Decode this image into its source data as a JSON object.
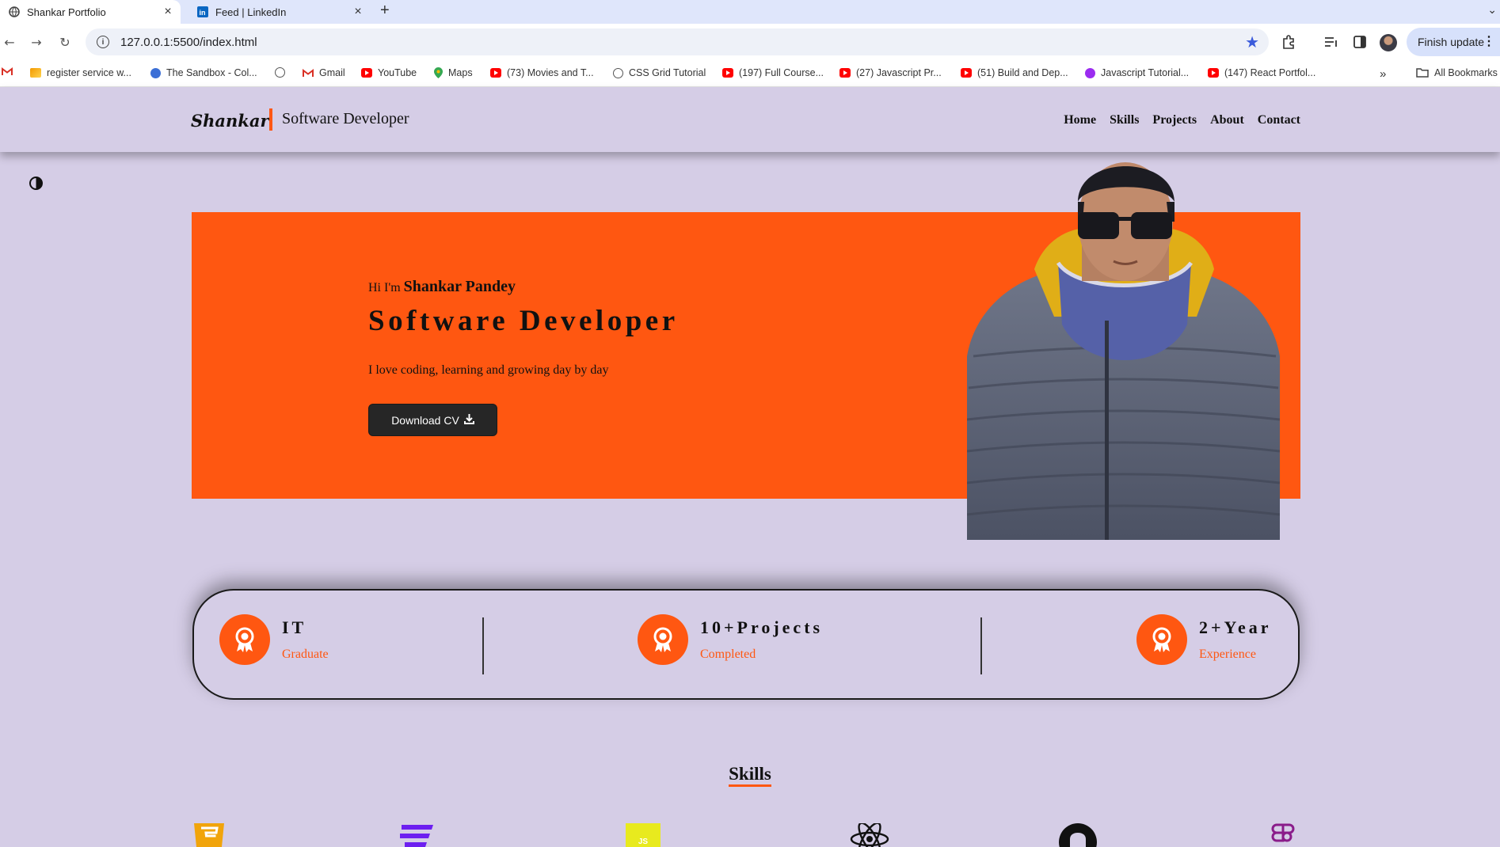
{
  "browser": {
    "tabs": [
      {
        "title": "Shankar Portfolio"
      },
      {
        "title": "Feed | LinkedIn"
      }
    ],
    "url": "127.0.0.1:5500/index.html",
    "finish_update_label": "Finish update",
    "bookmarks": [
      {
        "label": "register service w...",
        "icon": "bookmark-icon"
      },
      {
        "label": "The Sandbox - Col...",
        "icon": "sandbox-icon"
      },
      {
        "label": "",
        "icon": "globe-icon"
      },
      {
        "label": "Gmail",
        "icon": "gmail-icon"
      },
      {
        "label": "YouTube",
        "icon": "youtube-icon"
      },
      {
        "label": "Maps",
        "icon": "maps-icon"
      },
      {
        "label": "(73) Movies and T...",
        "icon": "youtube-icon"
      },
      {
        "label": "CSS Grid Tutorial",
        "icon": "globe-icon"
      },
      {
        "label": "(197) Full Course...",
        "icon": "youtube-icon"
      },
      {
        "label": "(27) Javascript Pr...",
        "icon": "youtube-icon"
      },
      {
        "label": "(51) Build and Dep...",
        "icon": "youtube-icon"
      },
      {
        "label": "Javascript Tutorial...",
        "icon": "bootstrap-icon"
      },
      {
        "label": "(147) React Portfol...",
        "icon": "youtube-icon"
      }
    ],
    "all_bookmarks_label": "All Bookmarks"
  },
  "header": {
    "logo": "Shankar",
    "subtitle": "Software Developer",
    "nav": [
      "Home",
      "Skills",
      "Projects",
      "About",
      "Contact"
    ]
  },
  "hero": {
    "greeting": "Hi I'm",
    "name": "Shankar Pandey",
    "role": "Software Developer",
    "tagline": "I love coding, learning and growing day by day",
    "cv_button": "Download CV"
  },
  "stats": [
    {
      "value": "IT",
      "label": "Graduate"
    },
    {
      "value": "10+Projects",
      "label": "Completed"
    },
    {
      "value": "2+Year",
      "label": "Experience"
    }
  ],
  "skills": {
    "title": "Skills",
    "icons": [
      "html5-icon",
      "css3-icon",
      "javascript-icon",
      "react-icon",
      "github-icon",
      "figma-icon"
    ]
  },
  "colors": {
    "accent": "#ff5711",
    "page_bg": "#d5cde6",
    "button_dark": "#262626"
  }
}
